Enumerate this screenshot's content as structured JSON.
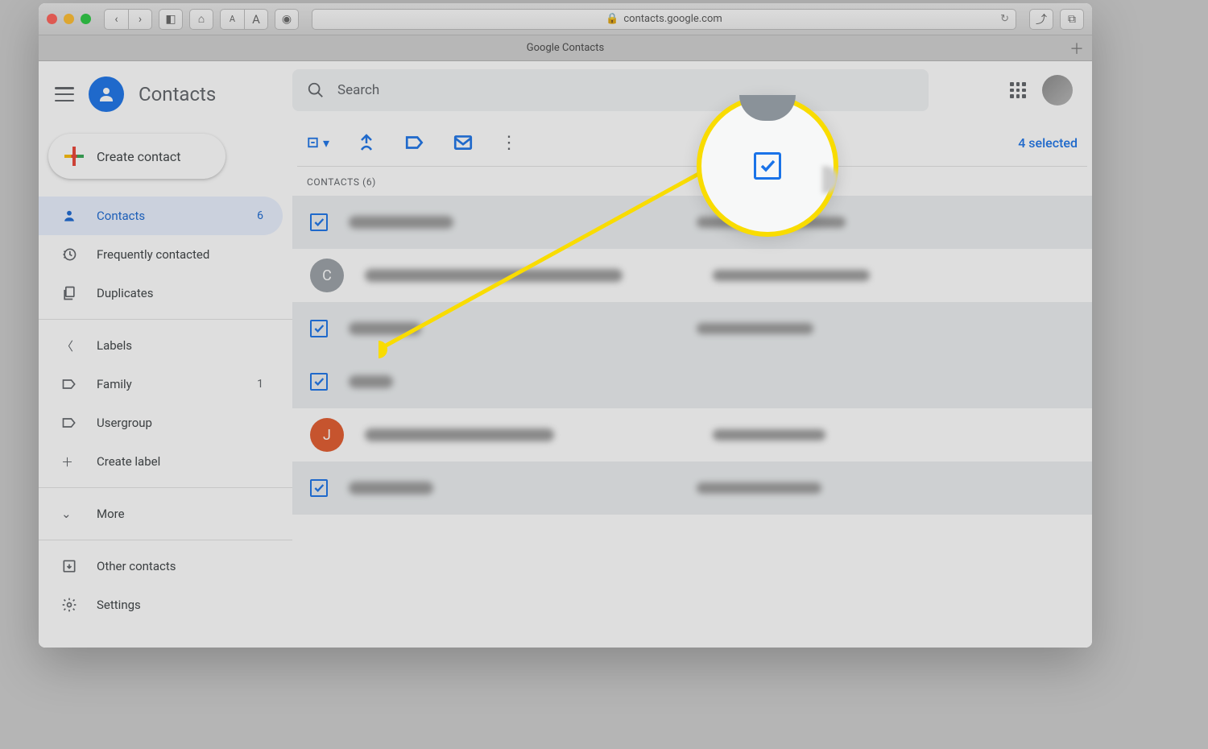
{
  "browser": {
    "url": "contacts.google.com",
    "tab_title": "Google Contacts"
  },
  "header": {
    "app_name": "Contacts",
    "search_placeholder": "Search"
  },
  "create_button": "Create contact",
  "sidebar": {
    "items": [
      {
        "label": "Contacts",
        "count": "6"
      },
      {
        "label": "Frequently contacted"
      },
      {
        "label": "Duplicates"
      }
    ],
    "labels_heading": "Labels",
    "labels": [
      {
        "label": "Family",
        "count": "1"
      },
      {
        "label": "Usergroup"
      }
    ],
    "create_label": "Create label",
    "more": "More",
    "other": "Other contacts",
    "settings": "Settings"
  },
  "toolbar": {
    "selected": "4 selected"
  },
  "list": {
    "heading": "CONTACTS (6)",
    "rows": [
      {
        "selected": true,
        "name_w": 130,
        "email_w": 185
      },
      {
        "selected": false,
        "avatar": "C",
        "color": "#9aa0a6",
        "name_w": 320,
        "email_w": 195
      },
      {
        "selected": true,
        "name_w": 90,
        "email_w": 145
      },
      {
        "selected": true,
        "name_w": 55,
        "email_w": 0
      },
      {
        "selected": false,
        "avatar": "J",
        "color": "#e25a2c",
        "name_w": 235,
        "email_w": 140
      },
      {
        "selected": true,
        "name_w": 105,
        "email_w": 155
      }
    ]
  }
}
